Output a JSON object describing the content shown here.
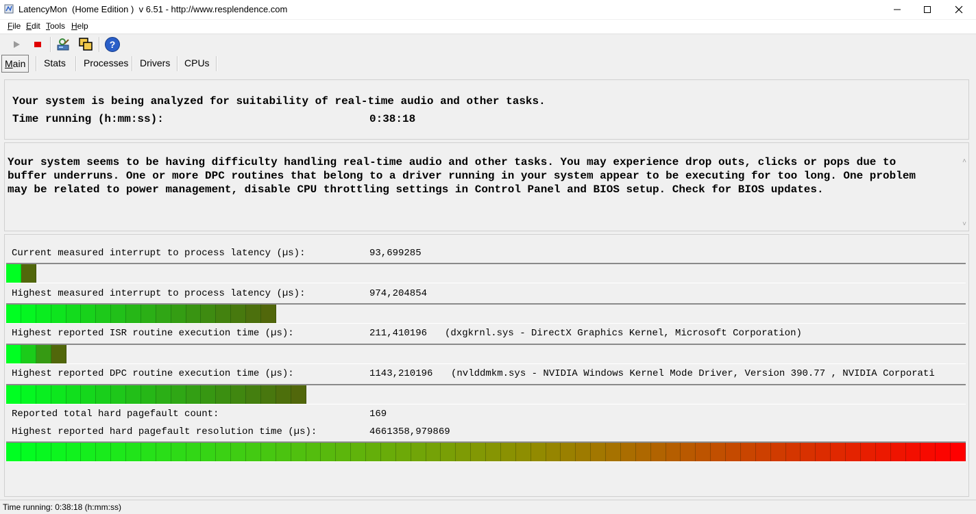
{
  "window": {
    "title": "LatencyMon  (Home Edition )  v 6.51 - http://www.resplendence.com"
  },
  "menu": [
    {
      "accel": "F",
      "rest": "ile"
    },
    {
      "accel": "E",
      "rest": "dit"
    },
    {
      "accel": "T",
      "rest": "ools"
    },
    {
      "accel": "H",
      "rest": "elp"
    }
  ],
  "toolbar": {
    "icons": [
      "play-icon",
      "stop-icon",
      "analyze-icon",
      "windows-icon",
      "help-icon"
    ]
  },
  "tabs": [
    {
      "accel": "M",
      "rest": "ain",
      "active": true
    },
    {
      "accel": "",
      "rest": "Stats",
      "active": false
    },
    {
      "accel": "",
      "rest": "Processes",
      "active": false
    },
    {
      "accel": "",
      "rest": "Drivers",
      "active": false
    },
    {
      "accel": "",
      "rest": "CPUs",
      "active": false
    }
  ],
  "summary": {
    "line1": "Your system is being analyzed for suitability of real-time audio and other tasks.",
    "time_label": "Time running (h:mm:ss):",
    "time_value": "0:38:18"
  },
  "conclusion": "Your system seems to be having difficulty handling real-time audio and other tasks. You may experience drop outs, clicks or pops due to\nbuffer underruns. One or more DPC routines that belong to a driver running in your system appear to be executing for too long. One problem\nmay be related to power management, disable CPU throttling settings in Control Panel and BIOS setup. Check for BIOS updates.",
  "metrics": {
    "current_latency": {
      "label": "Current measured interrupt to process latency (µs):",
      "value": "93,699285",
      "segments_lit": 2
    },
    "highest_latency": {
      "label": "Highest measured interrupt to process latency (µs):",
      "value": "974,204854",
      "segments_lit": 18
    },
    "isr": {
      "label": "Highest reported ISR routine execution time (µs):",
      "value": "211,410196",
      "extra": "(dxgkrnl.sys - DirectX Graphics Kernel, Microsoft Corporation)",
      "segments_lit": 4
    },
    "dpc": {
      "label": "Highest reported DPC routine execution time (µs):",
      "value": "1143,210196",
      "extra": "(nvlddmkm.sys - NVIDIA Windows Kernel Mode Driver, Version 390.77 , NVIDIA Corporati",
      "segments_lit": 20
    },
    "pagefault_count": {
      "label": "Reported total hard pagefault count:",
      "value": "169"
    },
    "pagefault_time": {
      "label": "Highest reported hard pagefault resolution time (µs):",
      "value": "4661358,979869",
      "segments_lit": 64
    },
    "total_segments": 64
  },
  "status": {
    "text": "Time running: 0:38:18  (h:mm:ss)"
  },
  "colors": {
    "green": "#00ff22",
    "red": "#ff0000",
    "stop_red": "#e00000",
    "help_blue": "#2a5fc8"
  }
}
